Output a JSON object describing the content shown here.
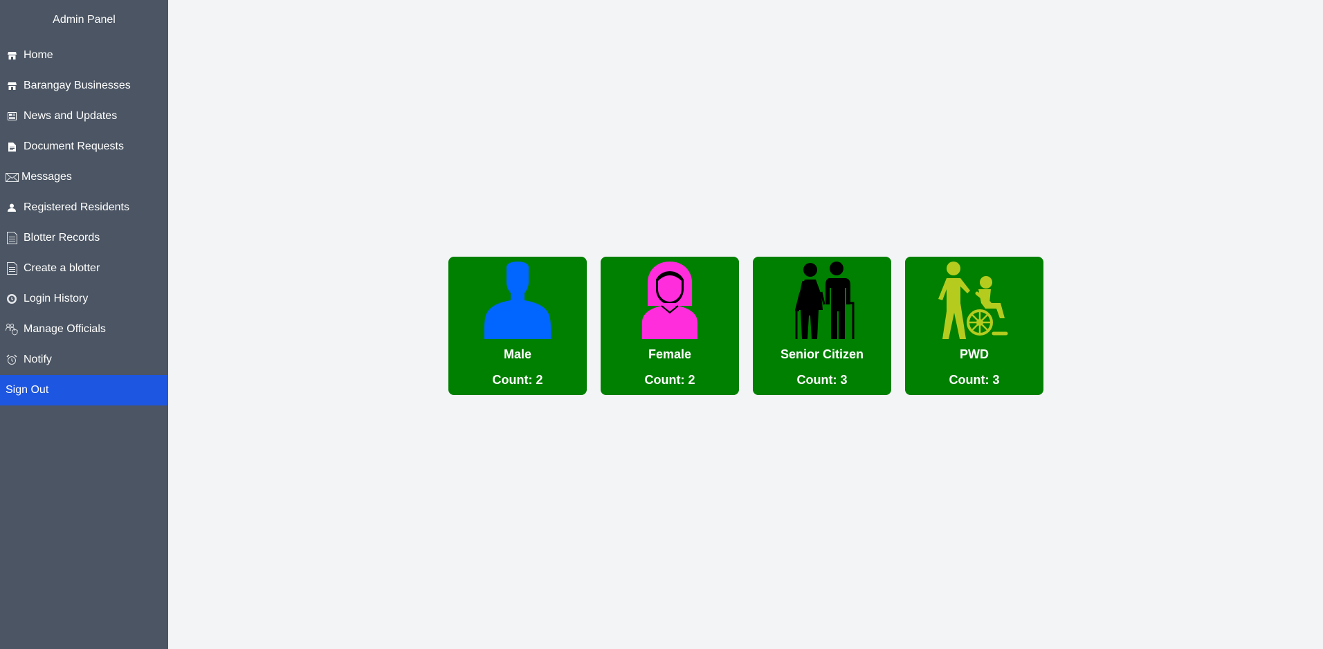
{
  "sidebar": {
    "title": "Admin Panel",
    "items": [
      {
        "label": "Home",
        "icon": "store-icon"
      },
      {
        "label": "Barangay Businesses",
        "icon": "store-icon"
      },
      {
        "label": "News and Updates",
        "icon": "newspaper-icon"
      },
      {
        "label": "Document Requests",
        "icon": "document-icon"
      },
      {
        "label": "Messages",
        "icon": "envelope-icon"
      },
      {
        "label": "Registered Residents",
        "icon": "user-icon"
      },
      {
        "label": "Blotter Records",
        "icon": "file-icon"
      },
      {
        "label": "Create a blotter",
        "icon": "file-icon"
      },
      {
        "label": "Login History",
        "icon": "history-icon"
      },
      {
        "label": "Manage Officials",
        "icon": "officials-icon"
      },
      {
        "label": "Notify",
        "icon": "alarm-icon"
      }
    ],
    "signout_label": "Sign Out",
    "signout_color": "#1d56e0"
  },
  "cards": [
    {
      "label": "Male",
      "count": "Count: 2",
      "icon": "male-person-icon",
      "icon_color": "#0066ff"
    },
    {
      "label": "Female",
      "count": "Count: 2",
      "icon": "female-person-icon",
      "icon_color": "#ff2ddc"
    },
    {
      "label": "Senior Citizen",
      "count": "Count: 3",
      "icon": "senior-couple-icon",
      "icon_color": "#000000"
    },
    {
      "label": "PWD",
      "count": "Count: 3",
      "icon": "wheelchair-icon",
      "icon_color": "#b5cc1f"
    }
  ],
  "colors": {
    "sidebar_bg": "#4b5563",
    "card_bg": "#008000",
    "page_bg": "#f3f4f6"
  }
}
